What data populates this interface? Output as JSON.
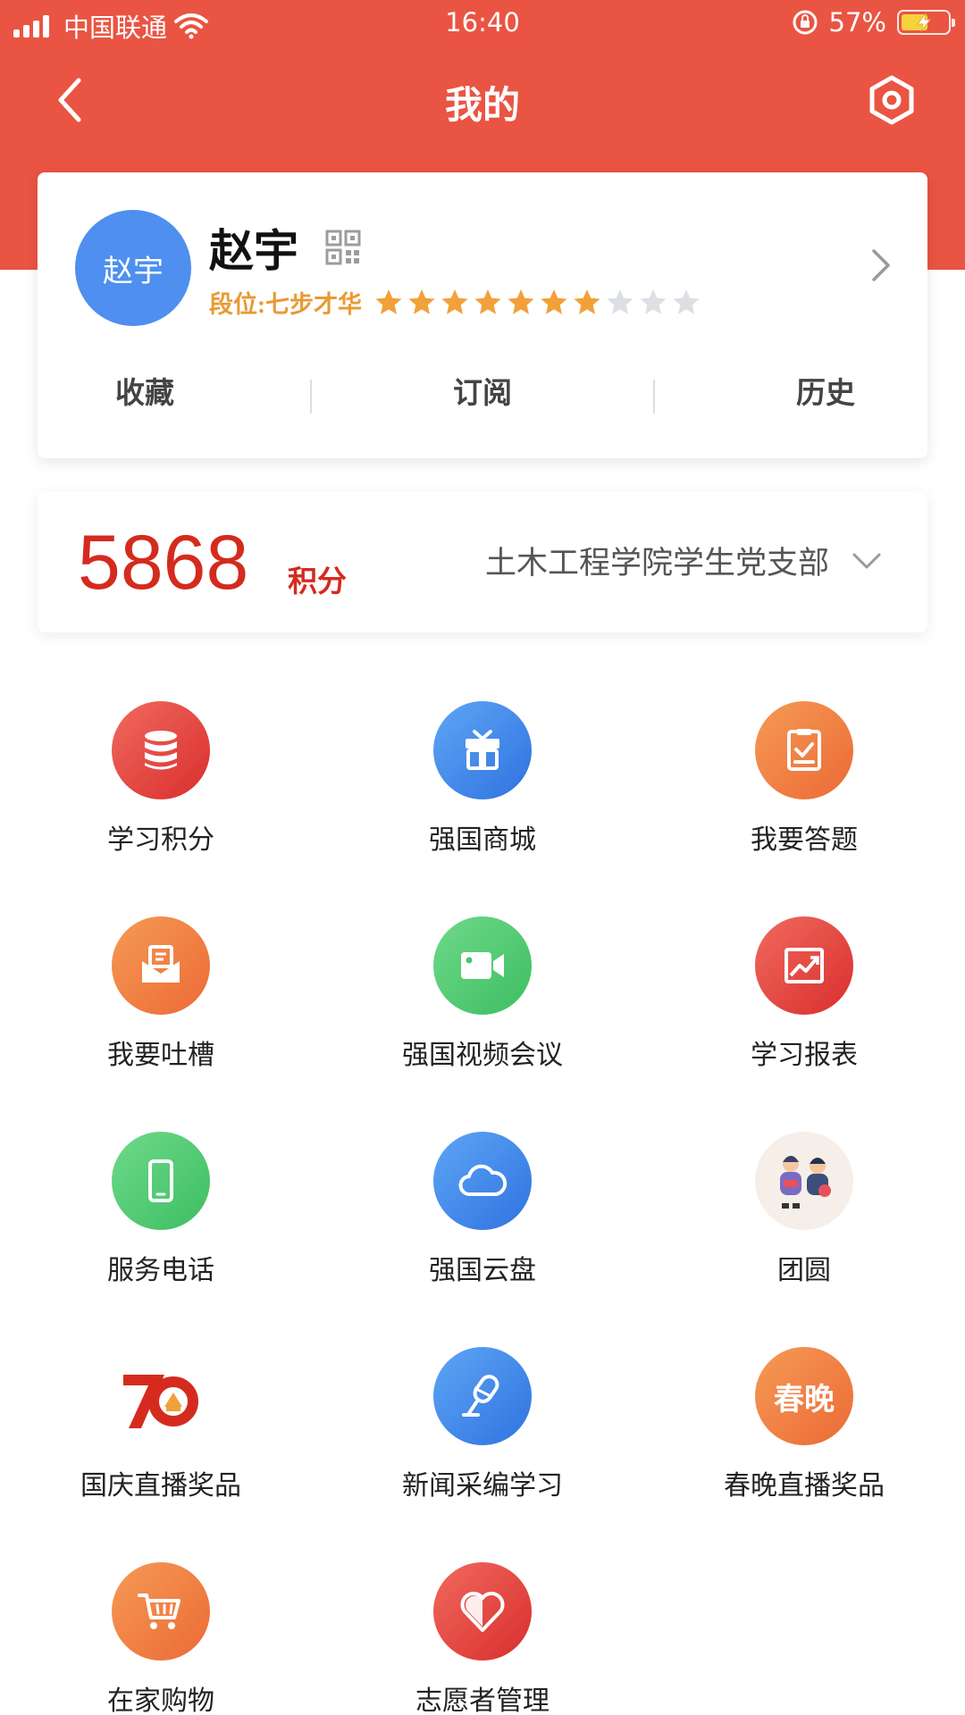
{
  "status_bar": {
    "carrier": "中国联通",
    "time": "16:40",
    "battery_percent": "57%",
    "battery_level": 0.57
  },
  "nav": {
    "title": "我的"
  },
  "profile": {
    "avatar_text": "赵宇",
    "name": "赵宇",
    "rank_label": "段位:七步才华",
    "stars_filled": 7,
    "stars_total": 10,
    "links": [
      "收藏",
      "订阅",
      "历史"
    ]
  },
  "points": {
    "value": "5868",
    "unit": "积分",
    "branch": "土木工程学院学生党支部"
  },
  "colors": {
    "header_red": "#EA5443",
    "star_gold": "#F2A13A",
    "points_red": "#D42B1E"
  },
  "menu": [
    {
      "label": "学习积分",
      "icon": "database-icon",
      "color": "red"
    },
    {
      "label": "强国商城",
      "icon": "gift-icon",
      "color": "blue"
    },
    {
      "label": "我要答题",
      "icon": "clipboard-check-icon",
      "color": "orange"
    },
    {
      "label": "我要吐槽",
      "icon": "mail-open-icon",
      "color": "orange"
    },
    {
      "label": "强国视频会议",
      "icon": "video-camera-icon",
      "color": "green"
    },
    {
      "label": "学习报表",
      "icon": "chart-report-icon",
      "color": "red"
    },
    {
      "label": "服务电话",
      "icon": "phone-icon",
      "color": "green"
    },
    {
      "label": "强国云盘",
      "icon": "cloud-icon",
      "color": "blue"
    },
    {
      "label": "团圆",
      "icon": "reunion-illustration-icon",
      "color": "beige"
    },
    {
      "label": "国庆直播奖品",
      "icon": "seventy-anniversary-logo",
      "color": "white"
    },
    {
      "label": "新闻采编学习",
      "icon": "microphone-icon",
      "color": "blue"
    },
    {
      "label": "春晚直播奖品",
      "icon": "spring-gala-icon",
      "color": "orange",
      "badge_text": "春晚"
    },
    {
      "label": "在家购物",
      "icon": "shopping-cart-icon",
      "color": "orange"
    },
    {
      "label": "志愿者管理",
      "icon": "heart-icon",
      "color": "red"
    }
  ]
}
